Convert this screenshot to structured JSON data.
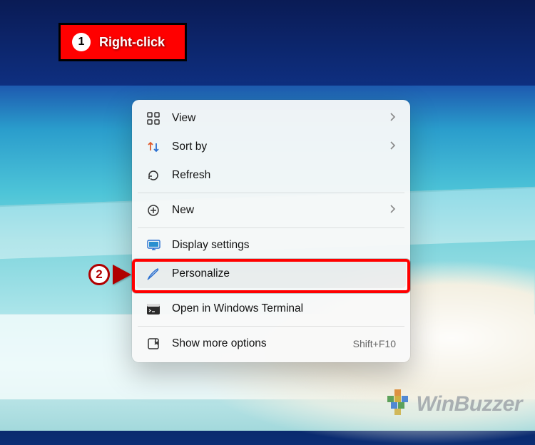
{
  "annotation1": {
    "step_num": "1",
    "label": "Right-click"
  },
  "annotation2": {
    "step_num": "2"
  },
  "menu": {
    "view": {
      "label": "View"
    },
    "sortby": {
      "label": "Sort by"
    },
    "refresh": {
      "label": "Refresh"
    },
    "new": {
      "label": "New"
    },
    "display": {
      "label": "Display settings"
    },
    "personalize": {
      "label": "Personalize"
    },
    "terminal": {
      "label": "Open in Windows Terminal"
    },
    "showmore": {
      "label": "Show more options",
      "shortcut": "Shift+F10"
    }
  },
  "watermark": {
    "text": "WinBuzzer"
  }
}
